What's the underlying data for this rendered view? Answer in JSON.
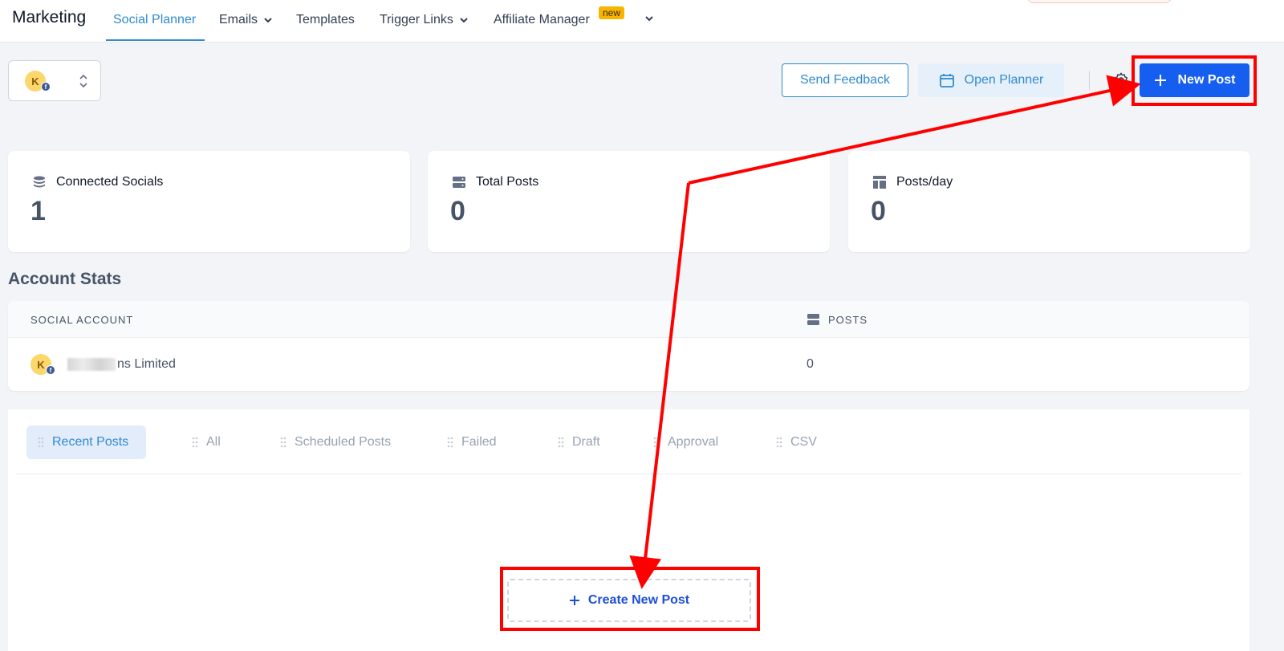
{
  "app": {
    "title": "Marketing"
  },
  "nav": {
    "items": [
      {
        "label": "Social Planner"
      },
      {
        "label": "Emails"
      },
      {
        "label": "Templates"
      },
      {
        "label": "Trigger Links"
      },
      {
        "label": "Affiliate Manager"
      }
    ],
    "new_badge": "new"
  },
  "account_switcher": {
    "avatar_initial": "K",
    "network_badge": "f"
  },
  "header": {
    "send_feedback": "Send Feedback",
    "open_planner": "Open Planner",
    "new_post": "New Post"
  },
  "stats": [
    {
      "label": "Connected Socials",
      "value": "1",
      "icon": "database-icon"
    },
    {
      "label": "Total Posts",
      "value": "0",
      "icon": "server-icon"
    },
    {
      "label": "Posts/day",
      "value": "0",
      "icon": "layout-icon"
    }
  ],
  "account_stats": {
    "title": "Account Stats",
    "columns": [
      "SOCIAL ACCOUNT",
      "POSTS"
    ],
    "rows": [
      {
        "avatar_initial": "K",
        "name": "ns Limited",
        "posts": "0"
      }
    ]
  },
  "post_tabs": [
    {
      "label": "Recent Posts"
    },
    {
      "label": "All"
    },
    {
      "label": "Scheduled Posts"
    },
    {
      "label": "Failed"
    },
    {
      "label": "Draft"
    },
    {
      "label": "Approval"
    },
    {
      "label": "CSV"
    }
  ],
  "empty_state": {
    "create_new_post": "Create New Post"
  },
  "colors": {
    "primary": "#155eef",
    "accent": "#2f8ad0",
    "annotation": "#ff0000",
    "badge": "#f7b500"
  }
}
